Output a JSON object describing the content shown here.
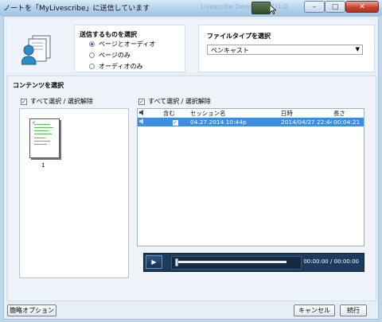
{
  "window": {
    "title": "ノートを「MyLivescribe」に送信しています",
    "background_app_title": "Livescribe Desktop(Lá1)1.0",
    "controls": {
      "minimize": "–",
      "maximize": "□",
      "close": "✕"
    }
  },
  "send_options": {
    "heading": "送信するものを選択",
    "options": [
      {
        "label": "ページとオーディオ",
        "selected": true
      },
      {
        "label": "ページのみ",
        "selected": false
      },
      {
        "label": "オーディオのみ",
        "selected": false
      }
    ]
  },
  "file_type": {
    "heading": "ファイルタイプを選択",
    "selected": "ペンキャスト"
  },
  "content": {
    "heading": "コンテンツを選択",
    "pages_select_all": "すべて選択 / 選択解除",
    "pages_select_all_checked": true,
    "page_thumb_number": "1",
    "sessions_select_all": "すべて選択 / 選択解除",
    "sessions_select_all_checked": true,
    "columns": {
      "speaker": "",
      "include": "含む",
      "name": "セッション名",
      "date": "日時",
      "length": "長さ"
    },
    "sessions": [
      {
        "include": true,
        "name": "04.27.2014 10:44p",
        "date": "2014/04/27 22:44",
        "length": "00:04:21",
        "selected": true
      }
    ]
  },
  "player": {
    "play_icon": "play-icon",
    "progress": 0.0,
    "time": "00:00:00 / 00:00:00"
  },
  "buttons": {
    "simple_options": "簡略オプション",
    "cancel": "キャンセル",
    "continue": "続行"
  },
  "colors": {
    "selection": "#3d8ee0",
    "player_bg": "#1c3a5e",
    "close_button": "#c9432d"
  }
}
